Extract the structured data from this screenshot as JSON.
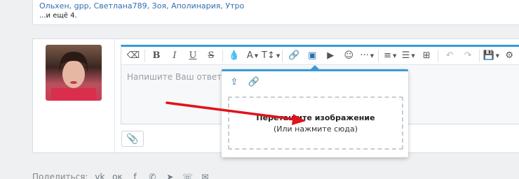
{
  "reactions": {
    "names": [
      "Ольхен",
      "gpp",
      "Светлана789",
      "Зоя",
      "Аполинария",
      "Утро"
    ],
    "more": "...и ещё 4."
  },
  "editor": {
    "placeholder": "Напишите Ваш ответ..."
  },
  "image_popup": {
    "drop_title": "Перетащите изображение",
    "drop_subtitle": "(Или нажмите сюда)"
  },
  "share": {
    "label": "Поделиться:"
  },
  "colors": {
    "accent": "#3a9ad9",
    "arrow": "#e0141c",
    "link": "#2f6fb0"
  }
}
